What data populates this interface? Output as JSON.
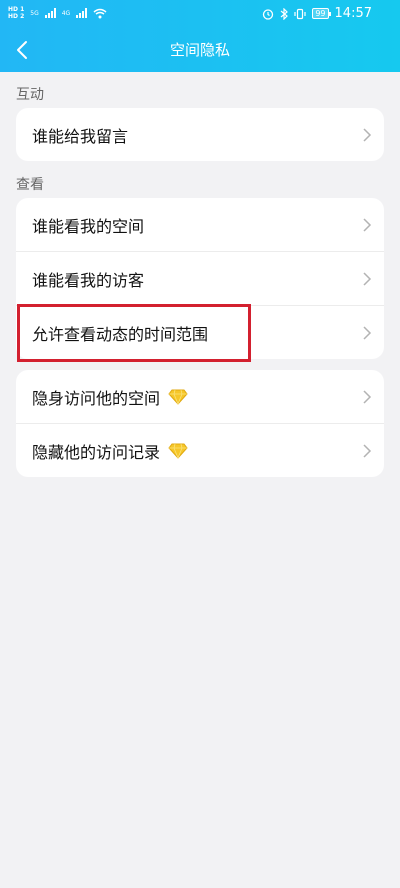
{
  "status_bar": {
    "left_badges": [
      "HD 1",
      "HD 2"
    ],
    "network_1": "5G",
    "network_2": "4G",
    "battery": "99",
    "time": "14:57"
  },
  "nav": {
    "title": "空间隐私"
  },
  "sections": [
    {
      "label": "互动",
      "items": [
        {
          "label": "谁能给我留言",
          "icon": "chevron-right",
          "premium": false
        }
      ]
    },
    {
      "label": "查看",
      "items": [
        {
          "label": "谁能看我的空间",
          "icon": "chevron-right",
          "premium": false
        },
        {
          "label": "谁能看我的访客",
          "icon": "chevron-right",
          "premium": false
        },
        {
          "label": "允许查看动态的时间范围",
          "icon": "chevron-right",
          "premium": false,
          "highlighted": true
        }
      ]
    },
    {
      "label": "",
      "items": [
        {
          "label": "隐身访问他的空间",
          "icon": "diamond-icon",
          "premium": true
        },
        {
          "label": "隐藏他的访问记录",
          "icon": "diamond-icon",
          "premium": true
        }
      ]
    }
  ],
  "colors": {
    "header_gradient_start": "#22b7f5",
    "header_gradient_end": "#16c9ef",
    "background": "#f2f2f4",
    "highlight_box": "#d3202f",
    "gem": "#f6c729"
  }
}
